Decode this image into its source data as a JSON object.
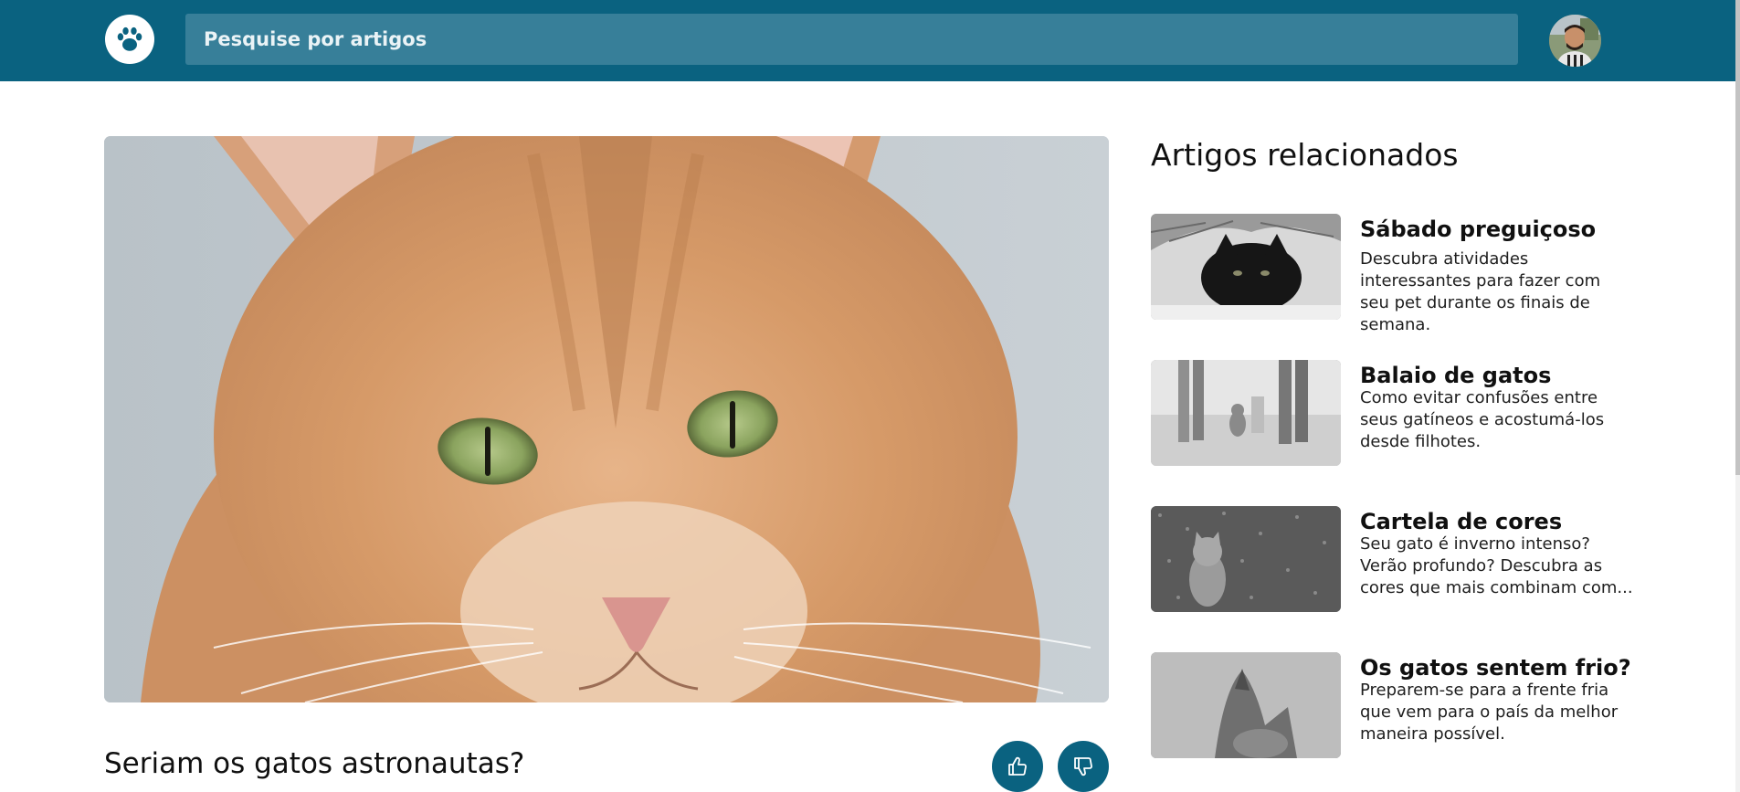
{
  "header": {
    "search_placeholder": "Pesquise por artigos",
    "logo_icon": "paw-icon",
    "avatar": "user-avatar"
  },
  "article": {
    "title": "Seriam os gatos astronautas?",
    "hero_image": "ginger-cat-photo",
    "like_icon": "thumbs-up-icon",
    "dislike_icon": "thumbs-down-icon"
  },
  "related": {
    "heading": "Artigos relacionados",
    "items": [
      {
        "title": "Sábado preguiçoso",
        "description": "Descubra atividades interessantes para fazer com seu pet durante os finais de semana."
      },
      {
        "title": "Balaio de gatos",
        "description": "Como evitar confusões entre seus gatíneos e acostumá-los desde filhotes."
      },
      {
        "title": "Cartela de cores",
        "description": "Seu gato é inverno intenso? Verão profundo? Descubra as cores que mais combinam com..."
      },
      {
        "title": "Os gatos sentem frio?",
        "description": "Preparem-se para a frente fria que vem para o país da melhor maneira possível."
      }
    ]
  },
  "colors": {
    "header_bg": "#0a6280",
    "search_bg": "#377f99",
    "button_bg": "#0a6280"
  }
}
